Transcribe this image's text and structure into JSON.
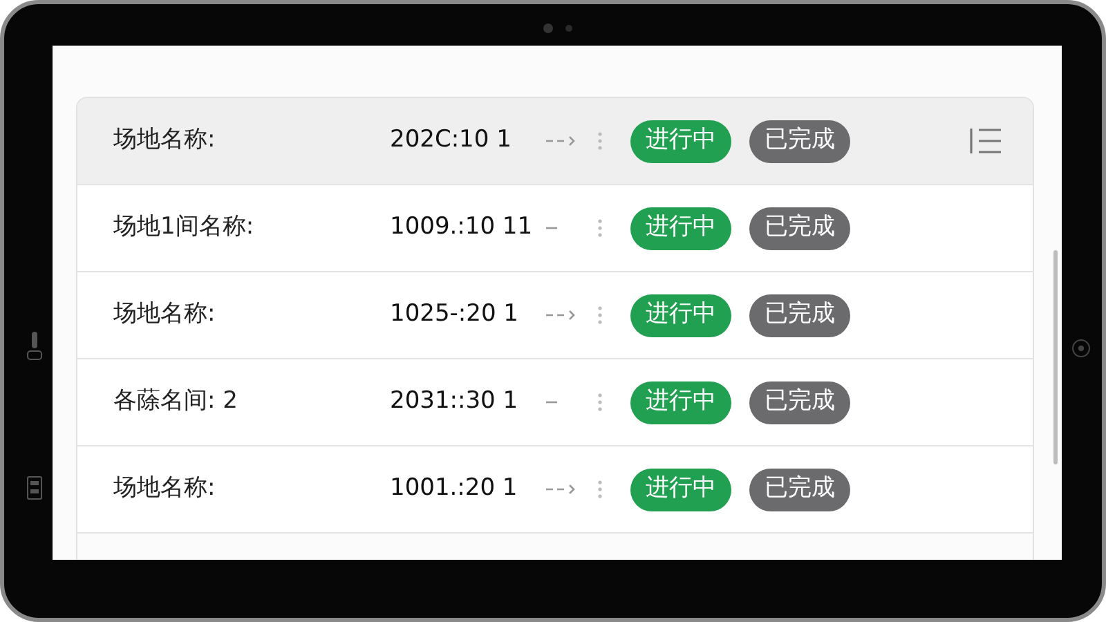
{
  "rows": [
    {
      "label": "场地名称:",
      "date": "202C:10 1",
      "arrow": true,
      "selected": true,
      "has_menu": true,
      "badges": [
        {
          "text": "进行中",
          "color": "#22a052"
        },
        {
          "text": "已完成",
          "color": "#6b6b6e"
        }
      ]
    },
    {
      "label": "场地1间名称:",
      "date": "1009.:10 11",
      "arrow": false,
      "selected": false,
      "has_menu": false,
      "badges": [
        {
          "text": "进行中",
          "color": "#22a052"
        },
        {
          "text": "已完成",
          "color": "#6b6b6e"
        }
      ]
    },
    {
      "label": "场地名称:",
      "date": "1025-:20 1",
      "arrow": true,
      "selected": false,
      "has_menu": false,
      "badges": [
        {
          "text": "进行中",
          "color": "#22a052"
        },
        {
          "text": "已完成",
          "color": "#6b6b6e"
        }
      ]
    },
    {
      "label": "各蒢名间: 2",
      "date": "2031::30 1",
      "arrow": false,
      "selected": false,
      "has_menu": false,
      "badges": [
        {
          "text": "进行中",
          "color": "#22a052"
        },
        {
          "text": "已完成",
          "color": "#6b6b6e"
        }
      ]
    },
    {
      "label": "场地名称:",
      "date": "1001.:20 1",
      "arrow": true,
      "selected": false,
      "has_menu": false,
      "badges": [
        {
          "text": "进行中",
          "color": "#22a052"
        },
        {
          "text": "已完成",
          "color": "#6b6b6e"
        }
      ]
    }
  ]
}
